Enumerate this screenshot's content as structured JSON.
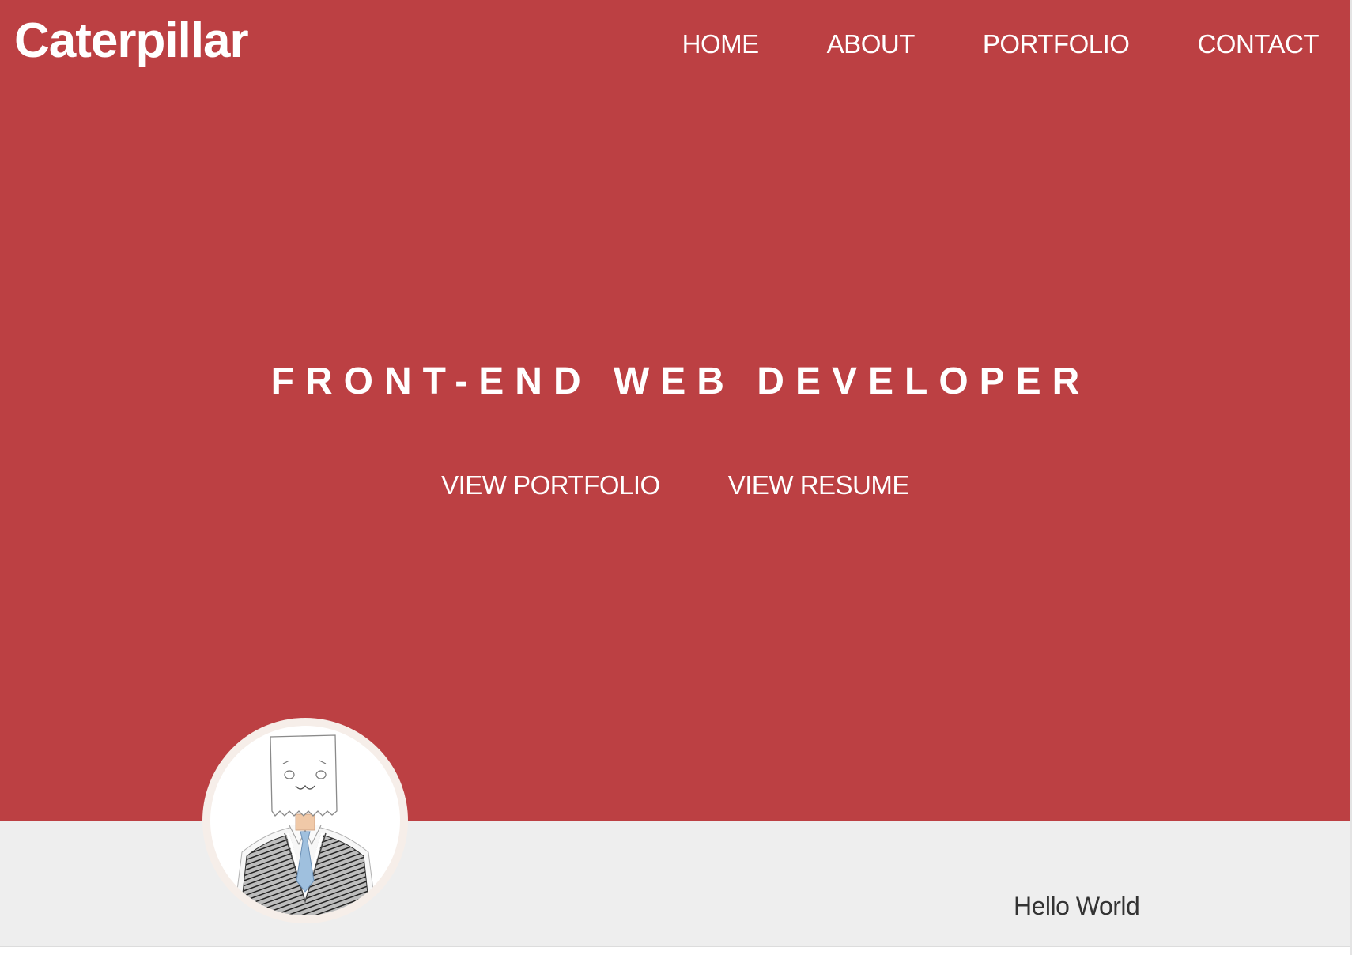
{
  "header": {
    "logo": "Caterpillar",
    "nav": [
      "HOME",
      "ABOUT",
      "PORTFOLIO",
      "CONTACT"
    ]
  },
  "hero": {
    "tagline": "FRONT-END WEB DEVELOPER",
    "actions": [
      "VIEW PORTFOLIO",
      "VIEW RESUME"
    ]
  },
  "about": {
    "avatar_icon": "paper-bag-head-character-illustration",
    "greeting": "Hello World"
  },
  "colors": {
    "hero_background": "#bc4043",
    "about_background": "#eeeeee",
    "hero_text": "#ffffff",
    "body_text": "#333333"
  }
}
